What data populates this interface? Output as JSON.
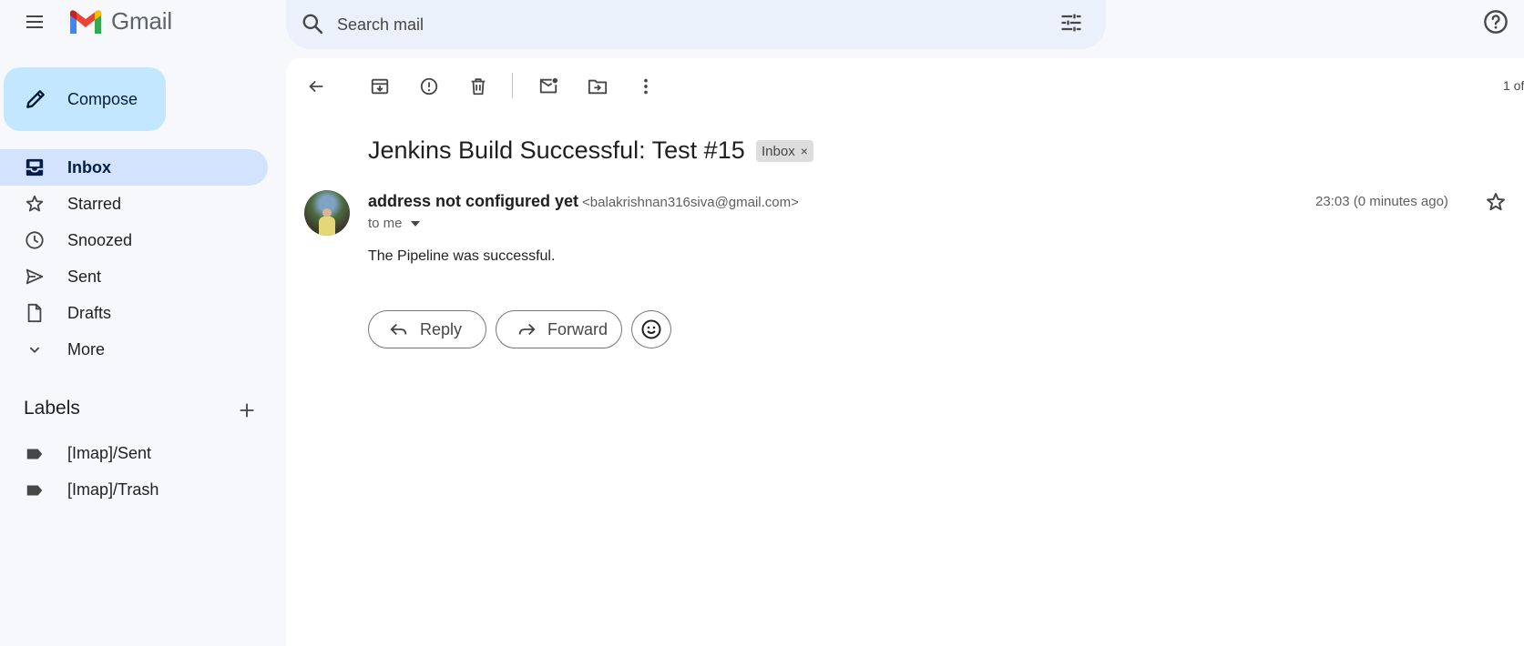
{
  "header": {
    "app_name": "Gmail",
    "search_placeholder": "Search mail"
  },
  "sidebar": {
    "compose_label": "Compose",
    "items": [
      {
        "label": "Inbox",
        "icon": "inbox-icon",
        "active": true
      },
      {
        "label": "Starred",
        "icon": "star-icon"
      },
      {
        "label": "Snoozed",
        "icon": "clock-icon"
      },
      {
        "label": "Sent",
        "icon": "send-icon"
      },
      {
        "label": "Drafts",
        "icon": "draft-icon"
      },
      {
        "label": "More",
        "icon": "chevron-down-icon"
      }
    ],
    "labels_heading": "Labels",
    "labels": [
      {
        "label": "[Imap]/Sent",
        "icon": "label-icon"
      },
      {
        "label": "[Imap]/Trash",
        "icon": "label-icon"
      }
    ]
  },
  "toolbar": {
    "pager_text": "1 of"
  },
  "message": {
    "subject": "Jenkins Build Successful: Test #15",
    "chip_label": "Inbox",
    "chip_close": "×",
    "sender_name": "address not configured yet",
    "sender_email": "<balakrishnan316siva@gmail.com>",
    "to_label": "to me",
    "timestamp": "23:03 (0 minutes ago)",
    "body": "The Pipeline was successful.",
    "reply_label": "Reply",
    "forward_label": "Forward"
  },
  "colors": {
    "page_bg": "#f6f8fc",
    "compose_bg": "#c2e7ff",
    "active_nav_bg": "#d3e3fd",
    "search_bg": "#eaf1fb"
  }
}
